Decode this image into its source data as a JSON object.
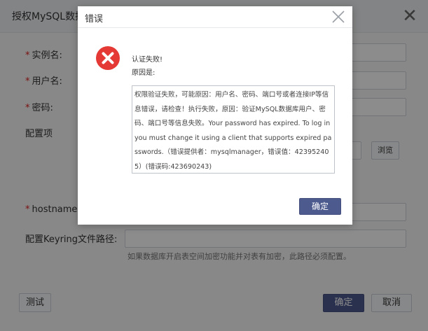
{
  "back_dialog": {
    "title": "授权MySQL数据库",
    "fields": {
      "instance_label": "实例名:",
      "username_label": "用户名:",
      "password_label": "密码:",
      "config_label": "配置项",
      "hostname_label": "hostname:",
      "keyring_label": "配置Keyring文件路径:"
    },
    "browse_label": "浏览",
    "keyring_hint": "如果数据库开启表空间加密功能并对表有加密，此路径必须配置。",
    "test_label": "测试",
    "confirm_label": "确定",
    "cancel_label": "取消"
  },
  "error_modal": {
    "title": "错误",
    "headline": "认证失败!",
    "reason_label": "原因是:",
    "detail": "权限验证失败，可能原因：用户名、密码、端口号或者连接IP等信息错误，请检查！执行失败，原因：验证MySQL数据库用户、密码、端口号等信息失败。Your password has expired. To log in you must change it using a client that supports expired passwords.（错误提供者：mysqlmanager，错误值：423952405）(错误码:423690243)",
    "ok_label": "确定"
  },
  "colors": {
    "primary": "#4d5a8e",
    "error_red": "#e53935",
    "required_star": "#e02020"
  },
  "icons": {
    "close": "close-icon",
    "error": "error-icon"
  }
}
